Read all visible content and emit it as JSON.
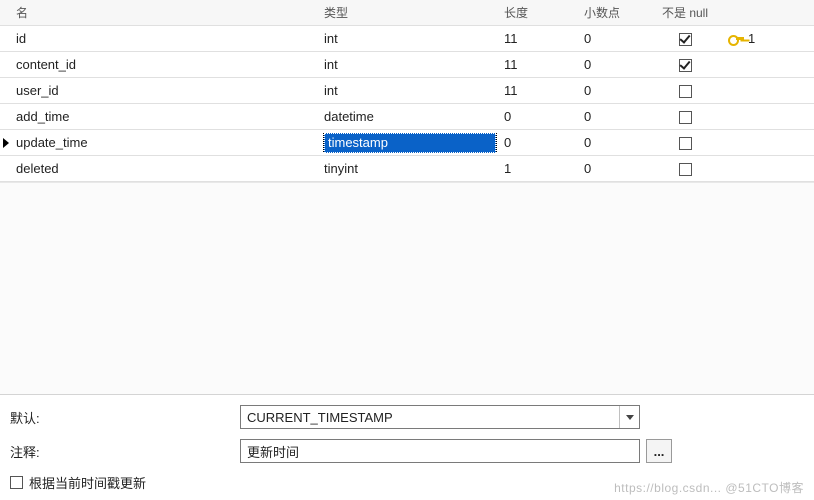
{
  "table": {
    "headers": {
      "name": "名",
      "type": "类型",
      "length": "长度",
      "decimal": "小数点",
      "notnull": "不是 null",
      "key": ""
    },
    "rows": [
      {
        "name": "id",
        "type": "int",
        "length": "11",
        "decimal": "0",
        "notnull": true,
        "pk": "1",
        "current": false,
        "type_selected": false
      },
      {
        "name": "content_id",
        "type": "int",
        "length": "11",
        "decimal": "0",
        "notnull": true,
        "pk": "",
        "current": false,
        "type_selected": false
      },
      {
        "name": "user_id",
        "type": "int",
        "length": "11",
        "decimal": "0",
        "notnull": false,
        "pk": "",
        "current": false,
        "type_selected": false
      },
      {
        "name": "add_time",
        "type": "datetime",
        "length": "0",
        "decimal": "0",
        "notnull": false,
        "pk": "",
        "current": false,
        "type_selected": false
      },
      {
        "name": "update_time",
        "type": "timestamp",
        "length": "0",
        "decimal": "0",
        "notnull": false,
        "pk": "",
        "current": true,
        "type_selected": true
      },
      {
        "name": "deleted",
        "type": "tinyint",
        "length": "1",
        "decimal": "0",
        "notnull": false,
        "pk": "",
        "current": false,
        "type_selected": false
      }
    ]
  },
  "detail": {
    "default_label": "默认:",
    "default_value": "CURRENT_TIMESTAMP",
    "comment_label": "注释:",
    "comment_value": "更新时间",
    "dots": "...",
    "on_update_label": "根据当前时间戳更新",
    "on_update_checked": false
  },
  "watermark": "https://blog.csdn... @51CTO博客"
}
